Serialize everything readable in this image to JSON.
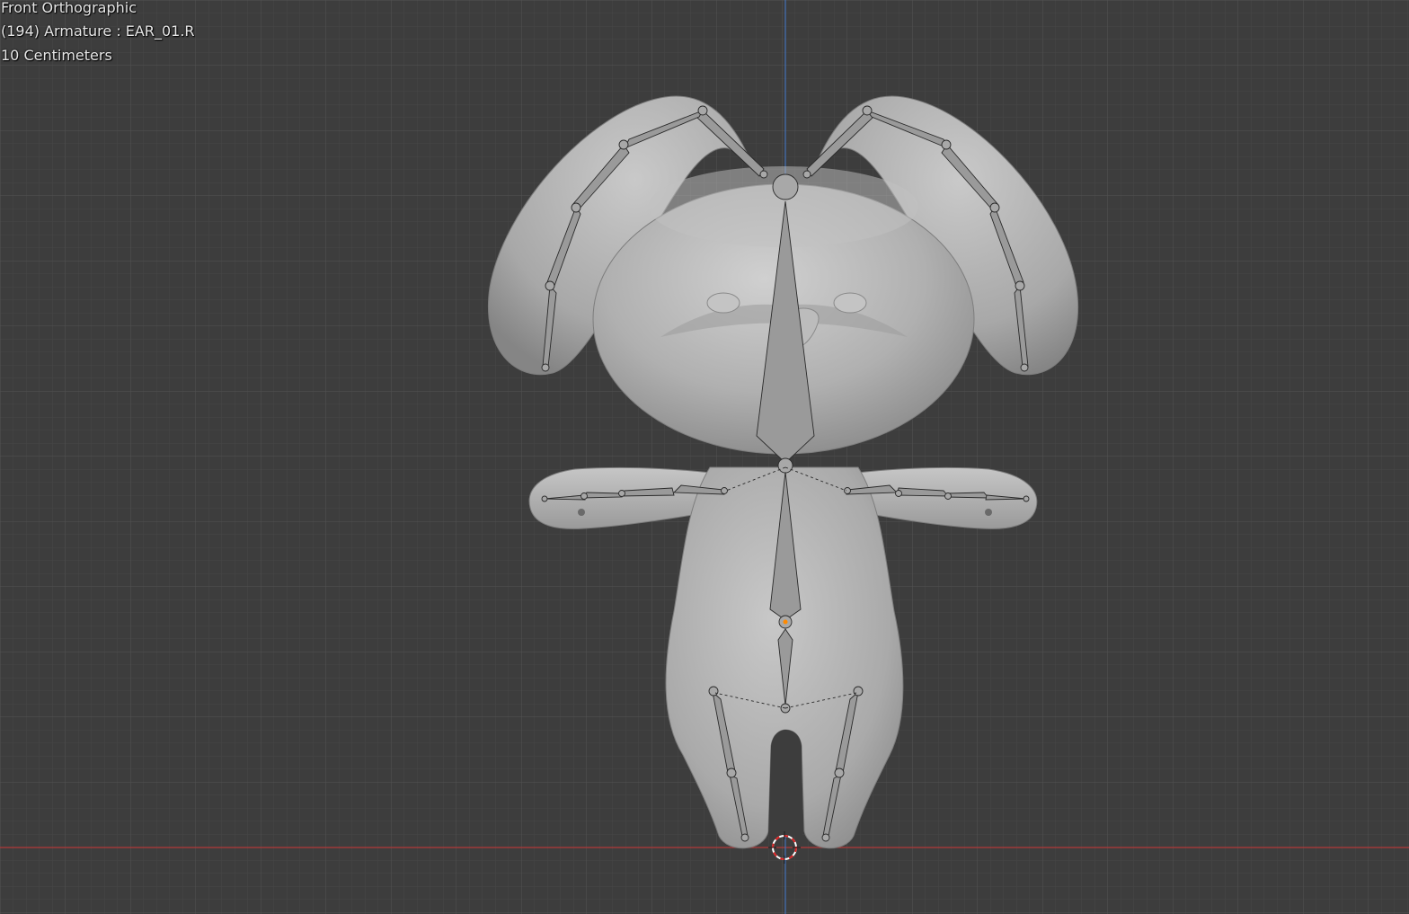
{
  "viewport": {
    "view_name": "Front Orthographic",
    "object_info": "(194) Armature : EAR_01.R",
    "scale_info": "10 Centimeters"
  },
  "colors": {
    "background": "#3d3d3d",
    "grid_minor": "#464646",
    "grid_major": "#505050",
    "x_axis": "#b33a3a",
    "z_axis": "#4472b8",
    "mesh": "#b5b5b5",
    "bone": "#9a9a9a",
    "selected_bone": "#ff8a00"
  },
  "icons": {
    "cursor": "3d-cursor-icon",
    "origin": "object-origin-icon"
  }
}
